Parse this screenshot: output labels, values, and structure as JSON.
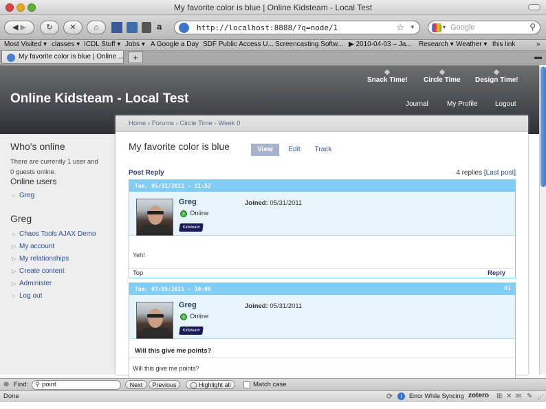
{
  "window": {
    "title": "My favorite color is blue | Online Kidsteam - Local Test",
    "url": "http://localhost:8888/?q=node/1",
    "search_placeholder": "Google"
  },
  "bookmarks": [
    "Most Visited ▾",
    "classes ▾",
    "ICDL Stuff ▾",
    "Jobs ▾",
    "A Google a Day",
    "SDF Public Access U...",
    "Screencasting Softw...",
    "▶ 2010-04-03 – Ja...",
    "Research ▾",
    "Weather ▾",
    "this link"
  ],
  "tab": {
    "label": "My favorite color is blue | Online ...",
    "new_tab": "+"
  },
  "site": {
    "name": "Online Kidsteam - Local Test",
    "primary_links": [
      "Snack Time!",
      "Circle Time",
      "Design Time!"
    ],
    "secondary_links": [
      "Journal",
      "My Profile",
      "Logout"
    ]
  },
  "sidebar": {
    "whos_online_title": "Who's online",
    "whos_online_text_1": "There are currently 1 user and",
    "whos_online_text_2": "0 guests online.",
    "online_users_title": "Online users",
    "online_user": "Greg",
    "user_block_title": "Greg",
    "menu": [
      "Chaos Tools AJAX Demo",
      "My account",
      "My relationships",
      "Create content",
      "Administer",
      "Log out"
    ]
  },
  "content": {
    "breadcrumb": "Home › Forums › Circle Time - Week 0",
    "title": "My favorite color is blue",
    "tabs": [
      "View",
      "Edit",
      "Track"
    ],
    "post_reply": "Post Reply",
    "replies": "4 replies",
    "last_post": "[Last post]",
    "posts": [
      {
        "date": "Tue, 05/31/2011 - 11:52",
        "number": "",
        "author": "Greg",
        "status": "Online",
        "badge": "Kidsteam",
        "joined_label": "Joined:",
        "joined": "05/31/2011",
        "subject": "",
        "body": "Yeh!",
        "top": "Top",
        "reply": "Reply"
      },
      {
        "date": "Tue, 07/05/2011 - 10:00",
        "number": "#1",
        "author": "Greg",
        "status": "Online",
        "badge": "Kidsteam",
        "joined_label": "Joined:",
        "joined": "05/31/2011",
        "subject": "Will this give me points?",
        "body": "Will this give me points?"
      }
    ]
  },
  "findbar": {
    "label": "Find:",
    "query": "point",
    "next": "Next",
    "previous": "Previous",
    "highlight": "Highlight all",
    "match_case": "Match case"
  },
  "statusbar": {
    "status": "Done",
    "sync": "Error While Syncing",
    "zotero": "zotero"
  }
}
